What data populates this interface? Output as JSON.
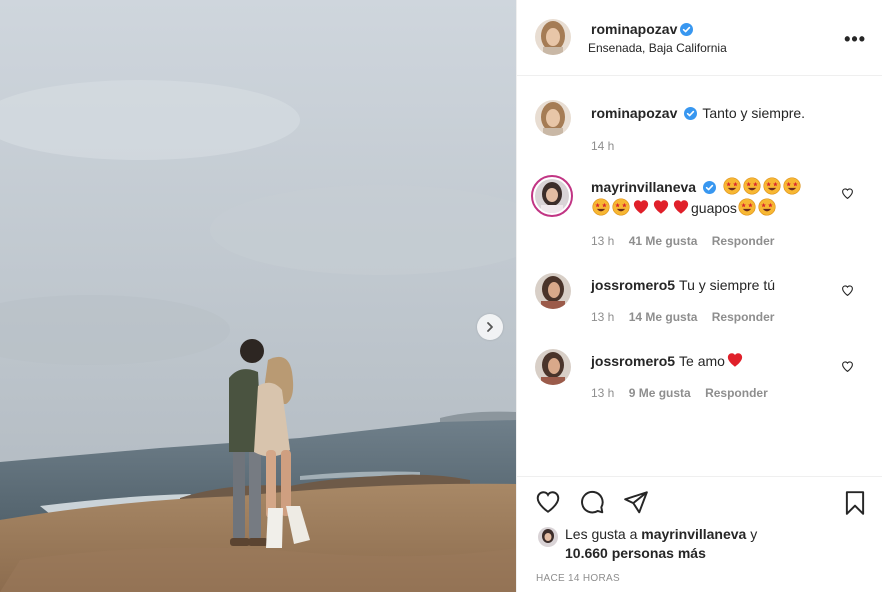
{
  "post": {
    "username": "rominapozav",
    "location": "Ensenada, Baja California",
    "caption": "Tanto y siempre.",
    "caption_time": "14 h"
  },
  "comments": [
    {
      "username": "mayrinvillaneva",
      "text_suffix": "guapos",
      "time": "13 h",
      "likes": "41 Me gusta",
      "reply": "Responder"
    },
    {
      "username": "jossromero5",
      "text": "Tu y siempre tú",
      "time": "13 h",
      "likes": "14 Me gusta",
      "reply": "Responder"
    },
    {
      "username": "jossromero5",
      "text": "Te amo",
      "time": "13 h",
      "likes": "9 Me gusta",
      "reply": "Responder"
    }
  ],
  "likes_summary": {
    "prefix": "Les gusta a",
    "user": "mayrinvillaneva",
    "joiner": "y",
    "others": "10.660 personas más"
  },
  "timestamp": "HACE 14 HORAS",
  "icons": {
    "verified": "verified-badge-icon",
    "more": "more-options-icon",
    "like": "heart-outline-icon",
    "comment": "comment-bubble-icon",
    "share": "paper-plane-icon",
    "save": "bookmark-icon",
    "next": "chevron-right-icon"
  },
  "colors": {
    "verified": "#3897f0",
    "red_heart": "#e0202a",
    "muted": "#8e8e8e",
    "text": "#262626"
  }
}
